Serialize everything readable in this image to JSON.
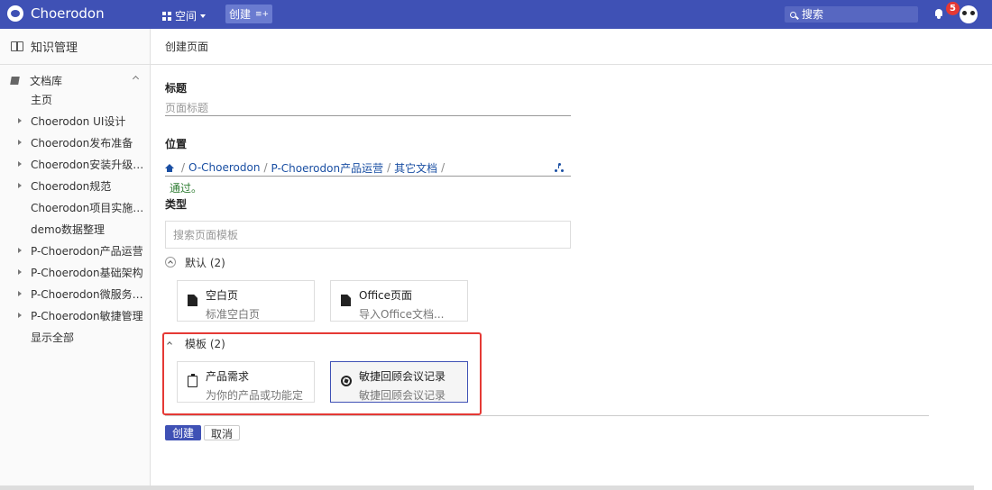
{
  "app": {
    "name": "Choerodon"
  },
  "topbar": {
    "space_label": "空间",
    "create_label": "创建",
    "search_placeholder": "搜索",
    "notification_count": "5"
  },
  "sidebar": {
    "title": "知识管理",
    "root_label": "文档库",
    "items": [
      {
        "label": "主页",
        "expandable": false
      },
      {
        "label": "Choerodon UI设计",
        "expandable": true
      },
      {
        "label": "Choerodon发布准备",
        "expandable": true
      },
      {
        "label": "Choerodon安装升级记...",
        "expandable": true
      },
      {
        "label": "Choerodon规范",
        "expandable": true
      },
      {
        "label": "Choerodon项目实施文...",
        "expandable": false
      },
      {
        "label": "demo数据整理",
        "expandable": false
      },
      {
        "label": "P-Choerodon产品运营",
        "expandable": true
      },
      {
        "label": "P-Choerodon基础架构",
        "expandable": true
      },
      {
        "label": "P-Choerodon微服务框...",
        "expandable": true
      },
      {
        "label": "P-Choerodon敏捷管理",
        "expandable": true
      },
      {
        "label": "显示全部",
        "expandable": false
      }
    ]
  },
  "main": {
    "header_title": "创建页面",
    "title_label": "标题",
    "title_placeholder": "页面标题",
    "location_label": "位置",
    "breadcrumb": [
      "O-Choerodon",
      "P-Choerodon产品运营",
      "其它文档"
    ],
    "breadcrumb_sep": "/",
    "validation_message": "通过。",
    "type_label": "类型",
    "template_search_placeholder": "搜索页面模板",
    "groups": [
      {
        "name": "默认 (2)",
        "templates": [
          {
            "title": "空白页",
            "desc": "标准空白页",
            "icon": "file-icon"
          },
          {
            "title": "Office页面",
            "desc": "导入Office文档...",
            "icon": "file-icon"
          }
        ]
      },
      {
        "name": "模板 (2)",
        "templates": [
          {
            "title": "产品需求",
            "desc": "为你的产品或功能定",
            "icon": "clipboard-icon"
          },
          {
            "title": "敏捷回顾会议记录",
            "desc": "敏捷回顾会议记录",
            "icon": "aperture-icon",
            "selected": true
          }
        ]
      }
    ],
    "create_button": "创建",
    "cancel_button": "取消"
  },
  "colors": {
    "primary": "#3f51b5",
    "link": "#1a4fa3",
    "success": "#2e7d32",
    "highlight": "#e53935"
  }
}
